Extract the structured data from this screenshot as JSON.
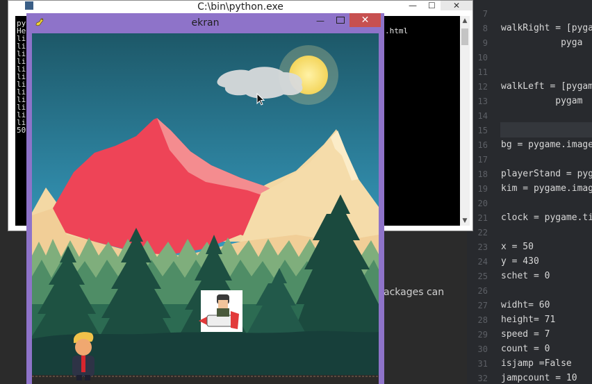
{
  "console": {
    "title": "C:\\bin\\python.exe",
    "min_glyph": "—",
    "max_glyph": "☐",
    "close_glyph": "✕",
    "lines": [
      "py",
      "He",
      "li",
      "li",
      "li",
      "li",
      "li",
      "li",
      "li",
      "li",
      "li",
      "li",
      "li",
      "li",
      "50"
    ],
    "right_text": ".html"
  },
  "behind": {
    "text": "ackages can"
  },
  "pygame_window": {
    "title": "ekran",
    "min_glyph": "—",
    "close_glyph": "✕"
  },
  "editor": {
    "line_numbers": [
      "7",
      "8",
      "9",
      "10",
      "11",
      "12",
      "13",
      "14",
      "15",
      "16",
      "17",
      "18",
      "19",
      "20",
      "21",
      "22",
      "23",
      "24",
      "25",
      "26",
      "27",
      "28",
      "29",
      "30",
      "31",
      "32"
    ],
    "code": [
      {
        "ln": "8",
        "text": "walkRight = [pyga"
      },
      {
        "ln": "9",
        "text": "           pyga"
      },
      {
        "ln": "12",
        "text": "walkLeft = [pygam"
      },
      {
        "ln": "13",
        "text": "          pygam"
      },
      {
        "ln": "16",
        "text": "bg = pygame.image"
      },
      {
        "ln": "18",
        "text": "playerStand = pyg"
      },
      {
        "ln": "19",
        "text": "kim = pygame.imag"
      },
      {
        "ln": "21",
        "text": "clock = pygame.ti"
      },
      {
        "ln": "23",
        "text": "x = 50"
      },
      {
        "ln": "24",
        "text": "y = 430"
      },
      {
        "ln": "25",
        "text": "schet = 0"
      },
      {
        "ln": "27",
        "text": "widht= 60"
      },
      {
        "ln": "28",
        "text": "height= 71"
      },
      {
        "ln": "29",
        "text": "speed = 7"
      },
      {
        "ln": "30",
        "text": "count = 0"
      },
      {
        "ln": "31",
        "text": "isjamp =False"
      },
      {
        "ln": "32",
        "text": "jampcount = 10"
      }
    ]
  },
  "colors": {
    "sky_top": "#1f5f73",
    "sky_bottom": "#3a9dbf",
    "mountain_red": "#f0485a",
    "mountain_cream": "#f6dcaa",
    "forest_dark": "#1b4a44",
    "sun": "#fbe27a"
  }
}
